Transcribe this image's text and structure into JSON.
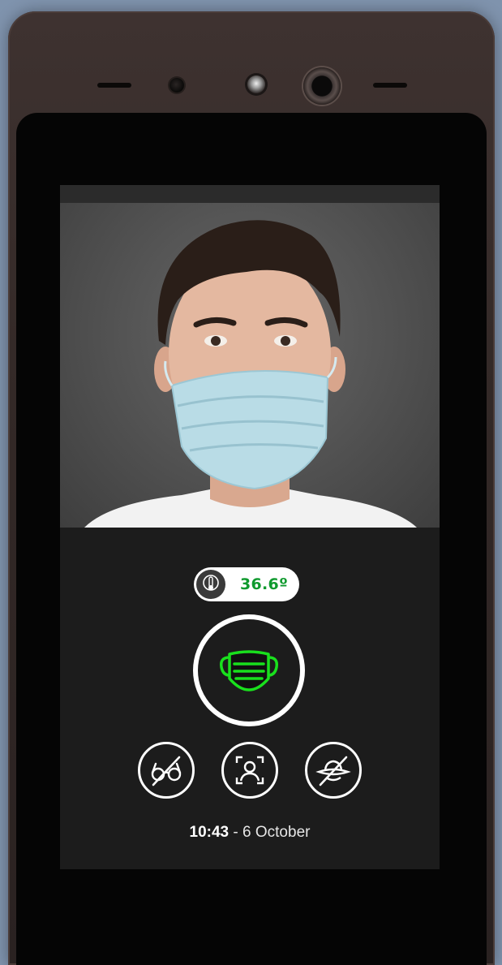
{
  "temperature": {
    "value": "36.6º",
    "icon": "thermometer-icon",
    "color": "#0f9a2e"
  },
  "status": {
    "mask_icon": "face-mask-icon",
    "mask_color": "#19e01d",
    "checks": [
      {
        "icon": "no-glasses-icon"
      },
      {
        "icon": "face-scan-icon"
      },
      {
        "icon": "no-hat-icon"
      }
    ]
  },
  "footer": {
    "time": "10:43",
    "separator": " - ",
    "date": "6 October"
  }
}
